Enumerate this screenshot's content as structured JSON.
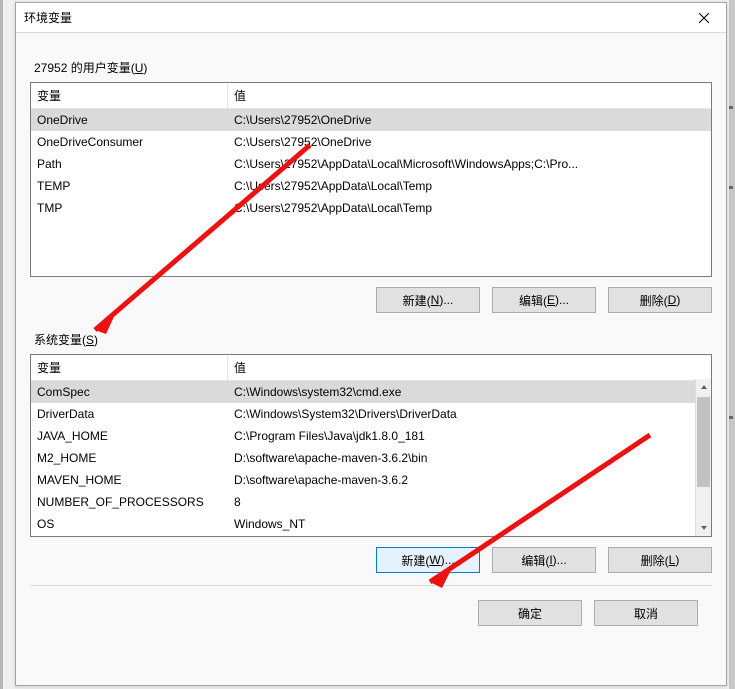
{
  "window": {
    "title": "环境变量"
  },
  "user": {
    "group_label_pre": "27952 的用户变量(",
    "group_label_ak": "U",
    "group_label_post": ")",
    "header_var": "变量",
    "header_val": "值",
    "rows": [
      {
        "var": "OneDrive",
        "val": "C:\\Users\\27952\\OneDrive"
      },
      {
        "var": "OneDriveConsumer",
        "val": "C:\\Users\\27952\\OneDrive"
      },
      {
        "var": "Path",
        "val": "C:\\Users\\27952\\AppData\\Local\\Microsoft\\WindowsApps;C:\\Pro..."
      },
      {
        "var": "TEMP",
        "val": "C:\\Users\\27952\\AppData\\Local\\Temp"
      },
      {
        "var": "TMP",
        "val": "C:\\Users\\27952\\AppData\\Local\\Temp"
      }
    ],
    "buttons": {
      "new_pre": "新建(",
      "new_ak": "N",
      "new_post": ")...",
      "edit_pre": "编辑(",
      "edit_ak": "E",
      "edit_post": ")...",
      "del_pre": "删除(",
      "del_ak": "D",
      "del_post": ")"
    }
  },
  "system": {
    "group_label_pre": "系统变量(",
    "group_label_ak": "S",
    "group_label_post": ")",
    "header_var": "变量",
    "header_val": "值",
    "rows": [
      {
        "var": "ComSpec",
        "val": "C:\\Windows\\system32\\cmd.exe"
      },
      {
        "var": "DriverData",
        "val": "C:\\Windows\\System32\\Drivers\\DriverData"
      },
      {
        "var": "JAVA_HOME",
        "val": "C:\\Program Files\\Java\\jdk1.8.0_181"
      },
      {
        "var": "M2_HOME",
        "val": "D:\\software\\apache-maven-3.6.2\\bin"
      },
      {
        "var": "MAVEN_HOME",
        "val": "D:\\software\\apache-maven-3.6.2"
      },
      {
        "var": "NUMBER_OF_PROCESSORS",
        "val": "8"
      },
      {
        "var": "OS",
        "val": "Windows_NT"
      }
    ],
    "buttons": {
      "new_pre": "新建(",
      "new_ak": "W",
      "new_post": ")...",
      "edit_pre": "编辑(",
      "edit_ak": "I",
      "edit_post": ")...",
      "del_pre": "删除(",
      "del_ak": "L",
      "del_post": ")"
    }
  },
  "footer": {
    "ok": "确定",
    "cancel": "取消"
  }
}
